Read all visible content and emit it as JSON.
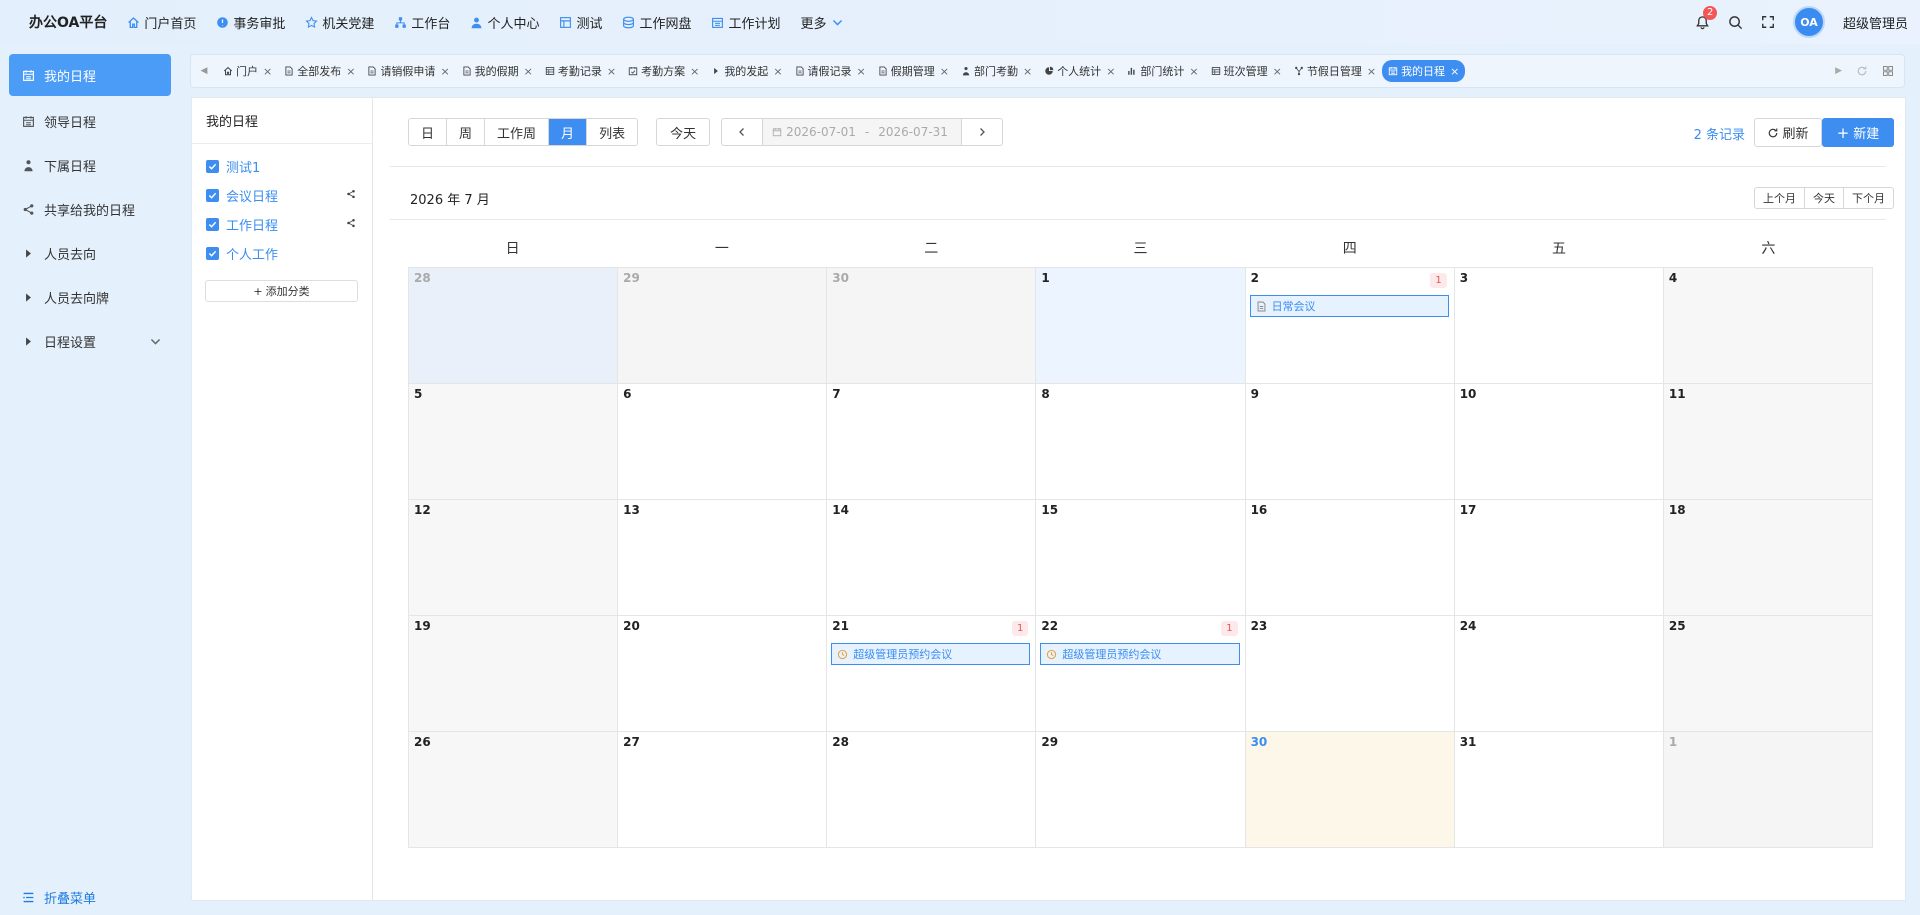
{
  "app": {
    "title": "办公OA平台"
  },
  "nav": [
    {
      "label": "门户首页",
      "icon": "home-icon"
    },
    {
      "label": "事务审批",
      "icon": "approval-icon"
    },
    {
      "label": "机关党建",
      "icon": "star-icon"
    },
    {
      "label": "工作台",
      "icon": "workbench-icon"
    },
    {
      "label": "个人中心",
      "icon": "user-icon"
    },
    {
      "label": "测试",
      "icon": "test-icon"
    },
    {
      "label": "工作网盘",
      "icon": "disk-icon"
    },
    {
      "label": "工作计划",
      "icon": "plan-icon"
    },
    {
      "label": "更多",
      "icon": "chevron-down-icon"
    }
  ],
  "header": {
    "notifications": "2",
    "avatar_text": "OA",
    "username": "超级管理员"
  },
  "sidebar": {
    "items": [
      {
        "label": "我的日程",
        "icon": "calendar-icon"
      },
      {
        "label": "领导日程",
        "icon": "calendar-icon"
      },
      {
        "label": "下属日程",
        "icon": "org-icon"
      },
      {
        "label": "共享给我的日程",
        "icon": "share-icon"
      },
      {
        "label": "人员去向",
        "icon": "caret-right-icon"
      },
      {
        "label": "人员去向牌",
        "icon": "caret-right-icon"
      },
      {
        "label": "日程设置",
        "icon": "caret-right-icon"
      }
    ],
    "collapse": "折叠菜单"
  },
  "tabs": [
    {
      "label": "门户",
      "icon": "home-icon"
    },
    {
      "label": "全部发布",
      "icon": "doc-icon"
    },
    {
      "label": "请销假申请",
      "icon": "doc-icon"
    },
    {
      "label": "我的假期",
      "icon": "doc-icon"
    },
    {
      "label": "考勤记录",
      "icon": "table-icon"
    },
    {
      "label": "考勤方案",
      "icon": "schedule-icon"
    },
    {
      "label": "我的发起",
      "icon": "caret-right-icon"
    },
    {
      "label": "请假记录",
      "icon": "doc-icon"
    },
    {
      "label": "假期管理",
      "icon": "doc-icon"
    },
    {
      "label": "部门考勤",
      "icon": "org-icon"
    },
    {
      "label": "个人统计",
      "icon": "pie-icon"
    },
    {
      "label": "部门统计",
      "icon": "bar-icon"
    },
    {
      "label": "班次管理",
      "icon": "table-icon"
    },
    {
      "label": "节假日管理",
      "icon": "branch-icon"
    },
    {
      "label": "我的日程",
      "icon": "calendar-icon"
    }
  ],
  "tab_close": "×",
  "panel": {
    "title": "我的日程",
    "categories": [
      {
        "label": "测试1",
        "shared": false
      },
      {
        "label": "会议日程",
        "shared": true
      },
      {
        "label": "工作日程",
        "shared": true
      },
      {
        "label": "个人工作",
        "shared": false
      }
    ],
    "add_category": "添加分类"
  },
  "toolbar": {
    "views": [
      "日",
      "周",
      "工作周",
      "月",
      "列表"
    ],
    "today": "今天",
    "date_start": "2026-07-01",
    "date_sep": "-",
    "date_end": "2026-07-31",
    "record_count": "2 条记录",
    "refresh": "刷新",
    "new": "新建"
  },
  "calendar": {
    "month_title": "2026 年 7 月",
    "month_nav": [
      "上个月",
      "今天",
      "下个月"
    ],
    "weekdays": [
      "日",
      "一",
      "二",
      "三",
      "四",
      "五",
      "六"
    ],
    "weeks": [
      [
        {
          "d": "28",
          "other": true,
          "shaded": true
        },
        {
          "d": "29",
          "other": true
        },
        {
          "d": "30",
          "other": true
        },
        {
          "d": "1",
          "selected": true
        },
        {
          "d": "2",
          "count": "1",
          "event": {
            "title": "日常会议",
            "icon": "doc-icon"
          }
        },
        {
          "d": "3"
        },
        {
          "d": "4"
        }
      ],
      [
        {
          "d": "5"
        },
        {
          "d": "6"
        },
        {
          "d": "7"
        },
        {
          "d": "8"
        },
        {
          "d": "9"
        },
        {
          "d": "10"
        },
        {
          "d": "11"
        }
      ],
      [
        {
          "d": "12"
        },
        {
          "d": "13"
        },
        {
          "d": "14"
        },
        {
          "d": "15"
        },
        {
          "d": "16"
        },
        {
          "d": "17"
        },
        {
          "d": "18"
        }
      ],
      [
        {
          "d": "19"
        },
        {
          "d": "20"
        },
        {
          "d": "21",
          "count": "1",
          "event": {
            "title": "超级管理员预约会议",
            "icon": "clock-icon"
          }
        },
        {
          "d": "22",
          "count": "1",
          "event": {
            "title": "超级管理员预约会议",
            "icon": "clock-icon"
          }
        },
        {
          "d": "23"
        },
        {
          "d": "24"
        },
        {
          "d": "25"
        }
      ],
      [
        {
          "d": "26"
        },
        {
          "d": "27"
        },
        {
          "d": "28"
        },
        {
          "d": "29"
        },
        {
          "d": "30",
          "today": true
        },
        {
          "d": "31"
        },
        {
          "d": "1",
          "other": true
        }
      ]
    ]
  },
  "colors": {
    "accent": "#3d8ef0",
    "badge": "#f45656",
    "today_bg": "#fdf7ea",
    "selected_bg": "#ebf4ff"
  }
}
